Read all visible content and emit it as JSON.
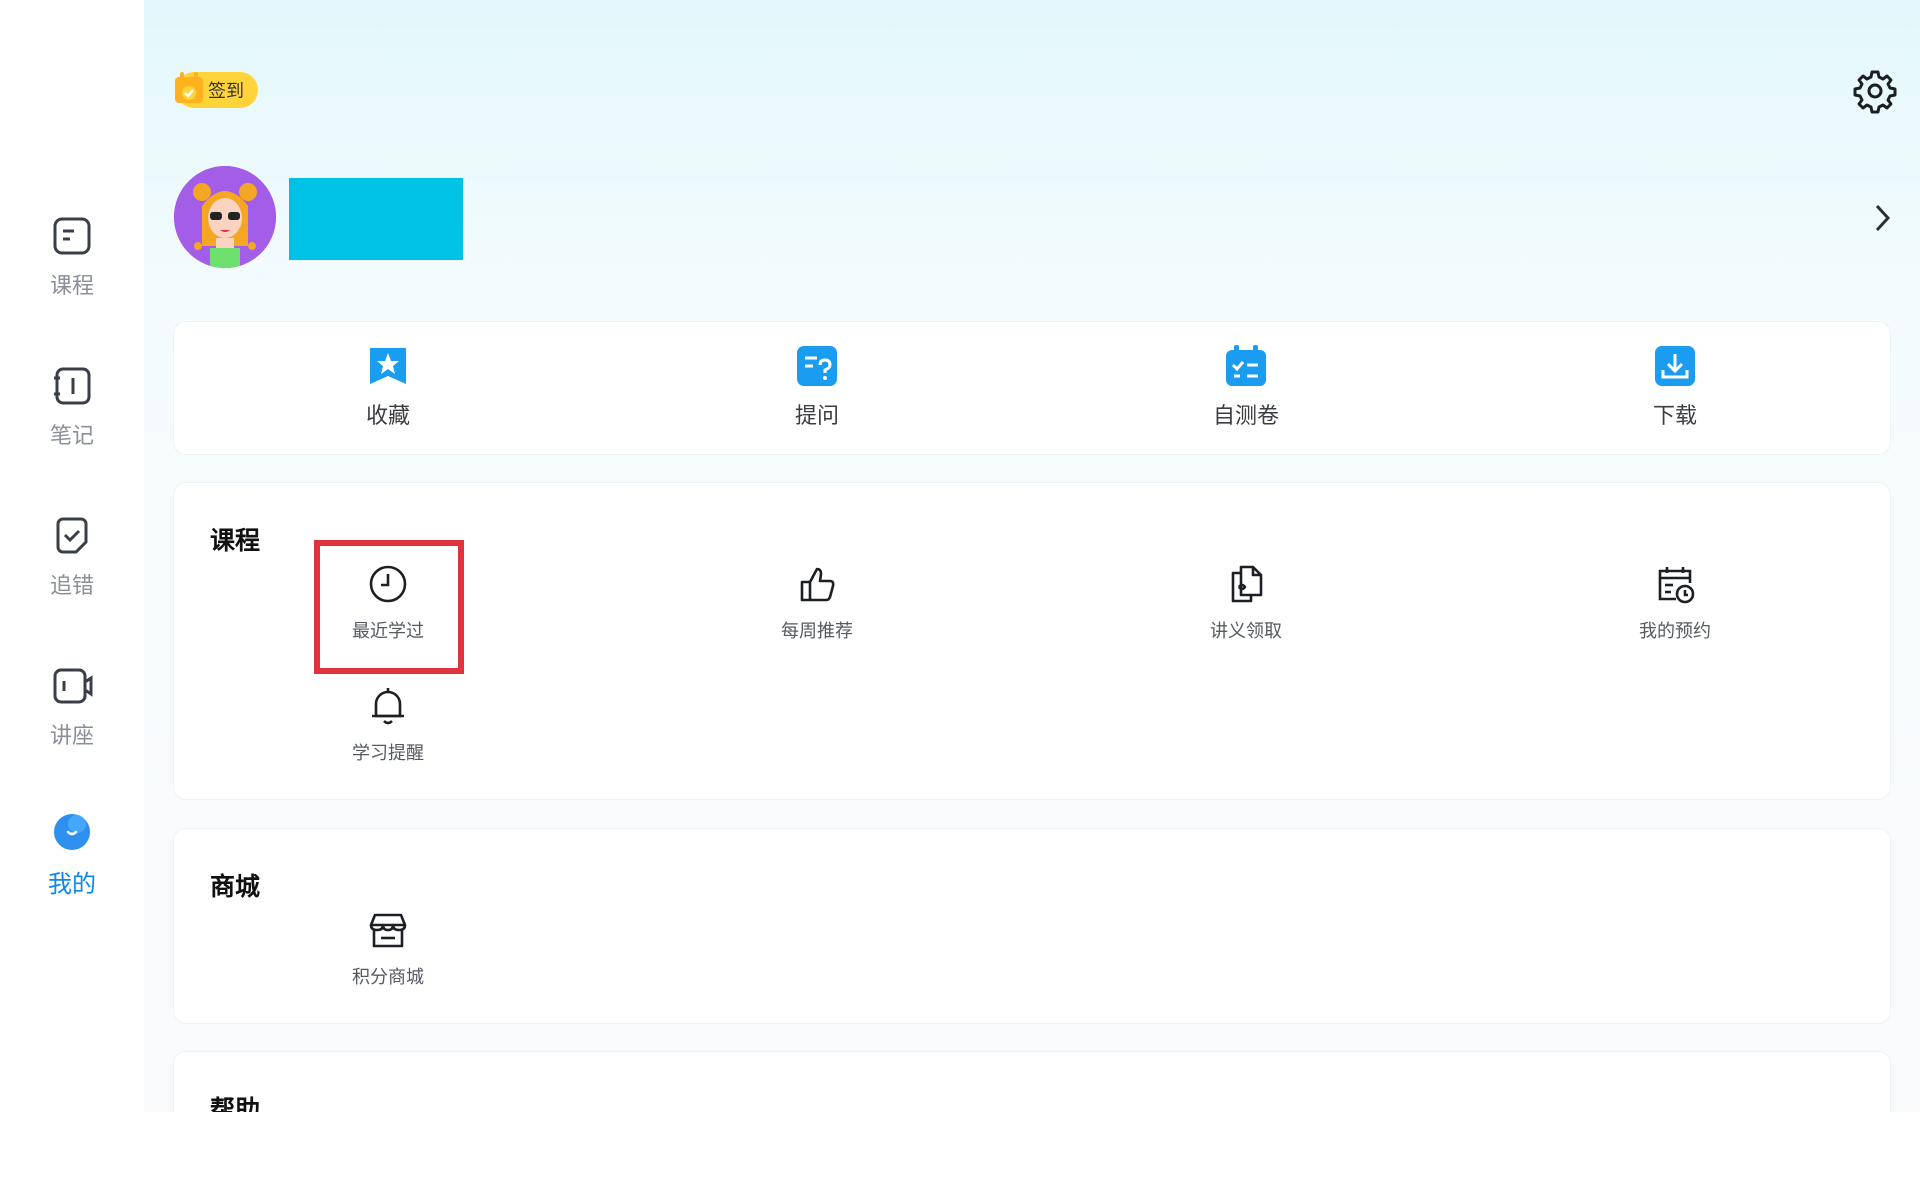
{
  "sidebar": {
    "items": [
      {
        "label": "课程",
        "icon": "course-icon",
        "active": false
      },
      {
        "label": "笔记",
        "icon": "notes-icon",
        "active": false
      },
      {
        "label": "追错",
        "icon": "mistakes-icon",
        "active": false
      },
      {
        "label": "讲座",
        "icon": "lecture-video-icon",
        "active": false
      },
      {
        "label": "我的",
        "icon": "profile-blob-icon",
        "active": true
      }
    ],
    "active_color": "#0a88f0"
  },
  "header": {
    "signin_label": "签到",
    "signin_color": "#ffd43a"
  },
  "quick_actions": [
    {
      "label": "收藏",
      "icon": "bookmark-star-icon"
    },
    {
      "label": "提问",
      "icon": "question-doc-icon"
    },
    {
      "label": "自测卷",
      "icon": "test-paper-icon"
    },
    {
      "label": "下载",
      "icon": "download-icon"
    }
  ],
  "courses": {
    "title": "课程",
    "items": [
      {
        "label": "最近学过",
        "icon": "clock-icon"
      },
      {
        "label": "每周推荐",
        "icon": "thumbs-up-icon"
      },
      {
        "label": "讲义领取",
        "icon": "handout-icon"
      },
      {
        "label": "我的预约",
        "icon": "calendar-clock-icon"
      },
      {
        "label": "学习提醒",
        "icon": "bell-icon"
      }
    ]
  },
  "mall": {
    "title": "商城",
    "items": [
      {
        "label": "积分商城",
        "icon": "store-icon"
      }
    ]
  },
  "help": {
    "title": "帮助"
  },
  "colors": {
    "accent_blue": "#1a9cf0",
    "username_redaction": "#00c2e6",
    "highlight_box": "#e0333d"
  }
}
